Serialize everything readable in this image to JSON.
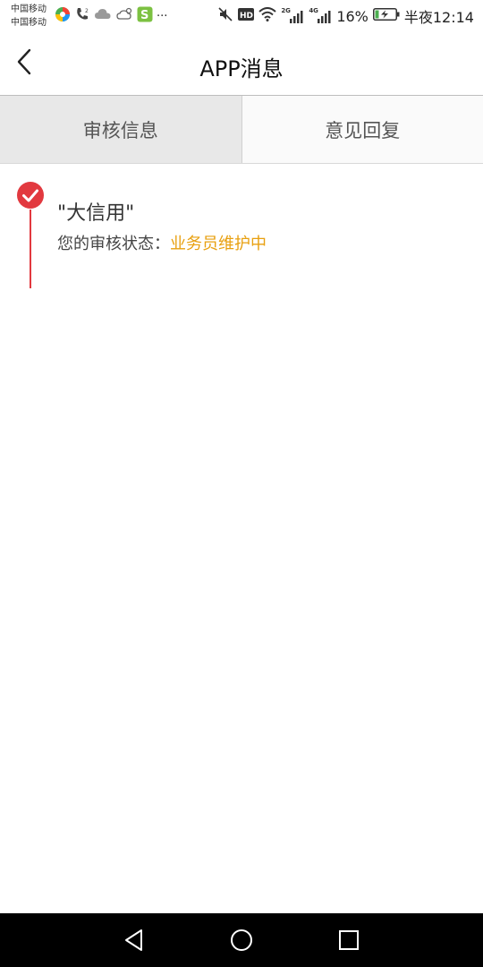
{
  "statusbar": {
    "carrier1": "中国移动",
    "carrier2": "中国移动",
    "network2g": "2G",
    "network4g": "4G",
    "battery": "16%",
    "time": "半夜12:14",
    "more": "···"
  },
  "header": {
    "title": "APP消息"
  },
  "tabs": [
    {
      "label": "审核信息",
      "active": true
    },
    {
      "label": "意见回复",
      "active": false
    }
  ],
  "messages": [
    {
      "title": "\"大信用\"",
      "status_label": "您的审核状态：",
      "status_value": "业务员维护中"
    }
  ],
  "colors": {
    "accent_red": "#e2393f",
    "status_orange": "#e8a010"
  },
  "icons": {
    "back": "back-arrow-icon",
    "nav_back": "nav-back-icon",
    "nav_home": "nav-home-icon",
    "nav_recent": "nav-recent-icon"
  }
}
